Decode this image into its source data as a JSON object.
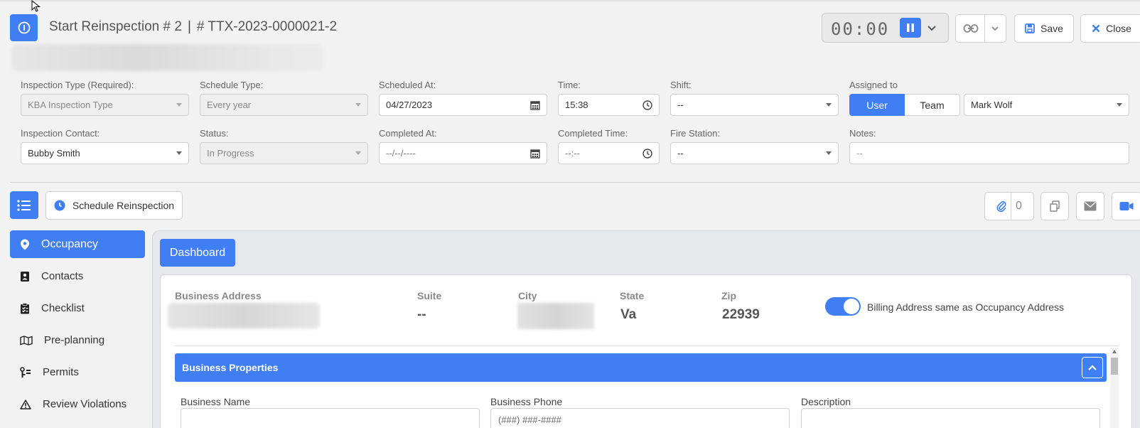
{
  "header": {
    "title": "Start Reinspection # 2",
    "separator": "|",
    "record_id": "# TTX-2023-0000021-2",
    "timer": "00:00",
    "save_label": "Save",
    "close_label": "Close"
  },
  "form": {
    "inspection_type": {
      "label": "Inspection Type (Required):",
      "value": "KBA Inspection Type"
    },
    "schedule_type": {
      "label": "Schedule Type:",
      "value": "Every year"
    },
    "scheduled_at": {
      "label": "Scheduled At:",
      "value": "04/27/2023"
    },
    "time": {
      "label": "Time:",
      "value": "15:38"
    },
    "shift": {
      "label": "Shift:",
      "value": "--"
    },
    "assigned_to": {
      "label": "Assigned to",
      "options": [
        "User",
        "Team"
      ],
      "selected": "User",
      "value": "Mark Wolf"
    },
    "inspection_contact": {
      "label": "Inspection Contact:",
      "value": "Bubby Smith"
    },
    "status": {
      "label": "Status:",
      "value": "In Progress"
    },
    "completed_at": {
      "label": "Completed At:",
      "value": "--/--/----"
    },
    "completed_time": {
      "label": "Completed Time:",
      "value": "--:--"
    },
    "fire_station": {
      "label": "Fire Station:",
      "value": "--"
    },
    "notes": {
      "label": "Notes:",
      "placeholder": "--"
    }
  },
  "toolbar": {
    "schedule_reinspection_label": "Schedule Reinspection",
    "attachment_count": "0"
  },
  "sidebar": {
    "items": [
      {
        "label": "Occupancy",
        "icon": "map-pin-icon",
        "active": true
      },
      {
        "label": "Contacts",
        "icon": "contact-card-icon",
        "active": false
      },
      {
        "label": "Checklist",
        "icon": "clipboard-check-icon",
        "active": false
      },
      {
        "label": "Pre-planning",
        "icon": "map-icon",
        "active": false
      },
      {
        "label": "Permits",
        "icon": "permits-icon",
        "active": false
      },
      {
        "label": "Review Violations",
        "icon": "warning-icon",
        "active": false
      }
    ]
  },
  "main": {
    "dashboard_label": "Dashboard",
    "address": {
      "business_address_label": "Business Address",
      "suite_label": "Suite",
      "suite_value": "--",
      "city_label": "City",
      "state_label": "State",
      "state_value": "Va",
      "zip_label": "Zip",
      "zip_value": "22939"
    },
    "billing_toggle": {
      "label": "Billing Address same as Occupancy Address",
      "on": true
    },
    "business_properties": {
      "title": "Business Properties",
      "business_name_label": "Business Name",
      "business_phone_label": "Business Phone",
      "business_phone_placeholder": "(###) ###-####",
      "description_label": "Description"
    }
  },
  "colors": {
    "accent": "#3f7ef3",
    "background": "#f2f2f2"
  }
}
